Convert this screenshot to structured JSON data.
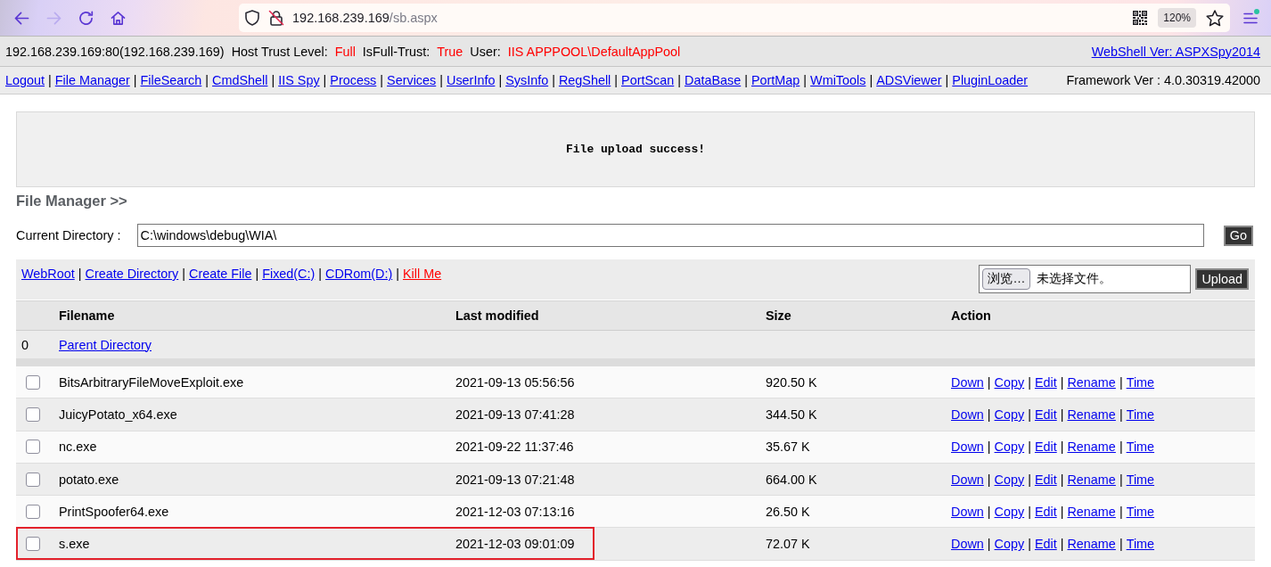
{
  "browser": {
    "nav_buttons": [
      {
        "kind": "back",
        "disabled": false
      },
      {
        "kind": "forward",
        "disabled": true
      },
      {
        "kind": "reload",
        "disabled": false
      },
      {
        "kind": "home",
        "disabled": false
      }
    ],
    "address": {
      "host": "192.168.239.169",
      "path": "/sb.aspx"
    },
    "zoom": "120%",
    "menu_badge": true
  },
  "info_bar": {
    "server": "192.168.239.169:80(192.168.239.169)",
    "fields": [
      {
        "label": "Host Trust Level:",
        "value": "Full"
      },
      {
        "label": "IsFull-Trust:",
        "value": "True"
      },
      {
        "label": "User:",
        "value": "IIS APPPOOL\\DefaultAppPool"
      }
    ],
    "version_link": "WebShell Ver: ASPXSpy2014"
  },
  "nav_bar": {
    "links": [
      "Logout",
      "File Manager",
      "FileSearch",
      "CmdShell",
      "IIS Spy",
      "Process",
      "Services",
      "UserInfo",
      "SysInfo",
      "RegShell",
      "PortScan",
      "DataBase",
      "PortMap",
      "WmiTools",
      "ADSViewer",
      "PluginLoader"
    ],
    "separator": "|",
    "framework": "Framework Ver : 4.0.30319.42000"
  },
  "message": "File upload success!",
  "section_title": "File Manager >>",
  "current_directory": {
    "label": "Current Directory :",
    "value": "C:\\windows\\debug\\WIA\\",
    "button": "Go"
  },
  "toolbar": {
    "links": [
      {
        "text": "WebRoot",
        "color": "#0000ee"
      },
      {
        "text": "Create Directory",
        "color": "#0000ee"
      },
      {
        "text": "Create File",
        "color": "#0000ee"
      },
      {
        "text": "Fixed(C:)",
        "color": "#0000ee"
      },
      {
        "text": "CDRom(D:)",
        "color": "#0000ee"
      },
      {
        "text": "Kill Me",
        "color": "#ff0000"
      }
    ],
    "separator": "|",
    "upload": {
      "browse_button": "浏览…",
      "status": "未选择文件。",
      "button": "Upload"
    }
  },
  "table": {
    "columns": [
      "Filename",
      "Last modified",
      "Size",
      "Action"
    ],
    "parent_row": {
      "index": "0",
      "link": "Parent Directory"
    },
    "rows": [
      {
        "checked": false,
        "highlighted": false,
        "filename": "BitsArbitraryFileMoveExploit.exe",
        "modified": "2021-09-13 05:56:56",
        "size": "920.50 K",
        "actions": [
          "Down",
          "Copy",
          "Edit",
          "Rename",
          "Time"
        ],
        "separator": "|"
      },
      {
        "checked": false,
        "highlighted": false,
        "filename": "JuicyPotato_x64.exe",
        "modified": "2021-09-13 07:41:28",
        "size": "344.50 K",
        "actions": [
          "Down",
          "Copy",
          "Edit",
          "Rename",
          "Time"
        ],
        "separator": "|"
      },
      {
        "checked": false,
        "highlighted": false,
        "filename": "nc.exe",
        "modified": "2021-09-22 11:37:46",
        "size": "35.67 K",
        "actions": [
          "Down",
          "Copy",
          "Edit",
          "Rename",
          "Time"
        ],
        "separator": "|"
      },
      {
        "checked": false,
        "highlighted": false,
        "filename": "potato.exe",
        "modified": "2021-09-13 07:21:48",
        "size": "664.00 K",
        "actions": [
          "Down",
          "Copy",
          "Edit",
          "Rename",
          "Time"
        ],
        "separator": "|"
      },
      {
        "checked": false,
        "highlighted": false,
        "filename": "PrintSpoofer64.exe",
        "modified": "2021-12-03 07:13:16",
        "size": "26.50 K",
        "actions": [
          "Down",
          "Copy",
          "Edit",
          "Rename",
          "Time"
        ],
        "separator": "|"
      },
      {
        "checked": false,
        "highlighted": true,
        "filename": "s.exe",
        "modified": "2021-12-03 09:01:09",
        "size": "72.07 K",
        "actions": [
          "Down",
          "Copy",
          "Edit",
          "Rename",
          "Time"
        ],
        "separator": "|"
      }
    ]
  }
}
